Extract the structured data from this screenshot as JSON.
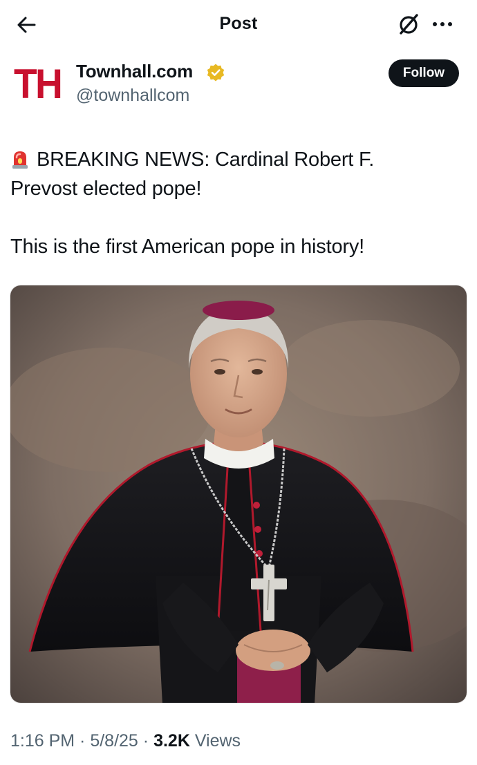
{
  "topbar": {
    "title": "Post"
  },
  "account": {
    "avatar_text": "TH",
    "display_name": "Townhall.com",
    "handle": "@townhallcom",
    "follow_label": "Follow"
  },
  "tweet": {
    "line1": "BREAKING NEWS: Cardinal Robert F.",
    "line2": "Prevost elected pope!",
    "line3": "This is the first American pope in history!"
  },
  "meta": {
    "time": "1:16 PM",
    "separator": " · ",
    "date": "5/8/25",
    "views_count": "3.2K",
    "views_label": " Views"
  },
  "icons": {
    "back": "arrow-left-icon",
    "grok": "grok-icon",
    "more": "more-horizontal-icon",
    "verified": "verified-gold-badge-icon",
    "siren": "siren-emoji-icon"
  },
  "colors": {
    "brand_red": "#c8102e",
    "text_primary": "#0f1419",
    "text_secondary": "#536471",
    "verified_gold": "#e8b923",
    "follow_bg": "#0f1419"
  }
}
